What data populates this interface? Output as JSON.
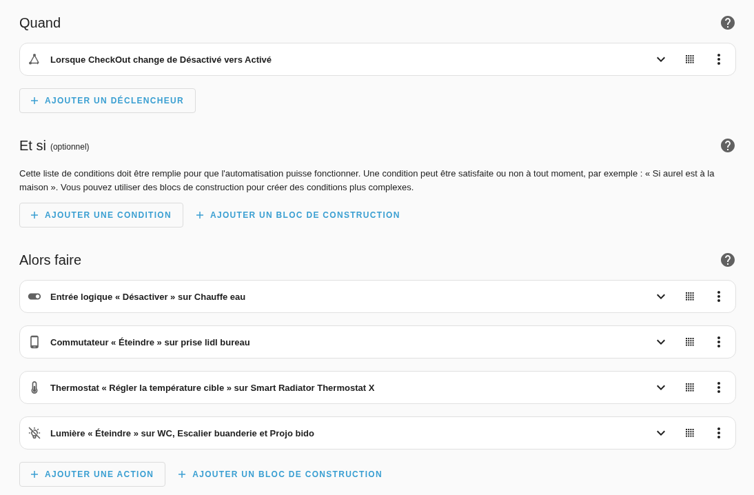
{
  "sections": [
    {
      "title": "Quand",
      "items": [
        {
          "kind": "trigger",
          "label": "Lorsque CheckOut change de Désactivé vers Activé"
        }
      ],
      "buttons": [
        {
          "kind": "outlined",
          "label": "AJOUTER UN DÉCLENCHEUR"
        }
      ]
    },
    {
      "title": "Et si",
      "subtitle": "(optionnel)",
      "description": "Cette liste de conditions doit être remplie pour que l'automatisation puisse fonctionner. Une condition peut être satisfaite ou non à tout moment, par exemple : « Si aurel est à la maison ». Vous pouvez utiliser des blocs de construction pour créer des conditions plus complexes.",
      "buttons": [
        {
          "kind": "outlined",
          "label": "AJOUTER UNE CONDITION"
        },
        {
          "kind": "text",
          "label": "AJOUTER UN BLOC DE CONSTRUCTION"
        }
      ]
    },
    {
      "title": "Alors faire",
      "items": [
        {
          "kind": "toggle",
          "label": "Entrée logique « Désactiver » sur Chauffe eau"
        },
        {
          "kind": "switch",
          "label": "Commutateur « Éteindre » sur prise lidl bureau"
        },
        {
          "kind": "thermostat",
          "label": "Thermostat « Régler la température cible » sur Smart Radiator Thermostat X"
        },
        {
          "kind": "light",
          "label": "Lumière « Éteindre » sur WC, Escalier buanderie et Projo bido"
        }
      ],
      "buttons": [
        {
          "kind": "outlined",
          "label": "AJOUTER UNE ACTION"
        },
        {
          "kind": "text",
          "label": "AJOUTER UN BLOC DE CONSTRUCTION"
        }
      ]
    }
  ]
}
